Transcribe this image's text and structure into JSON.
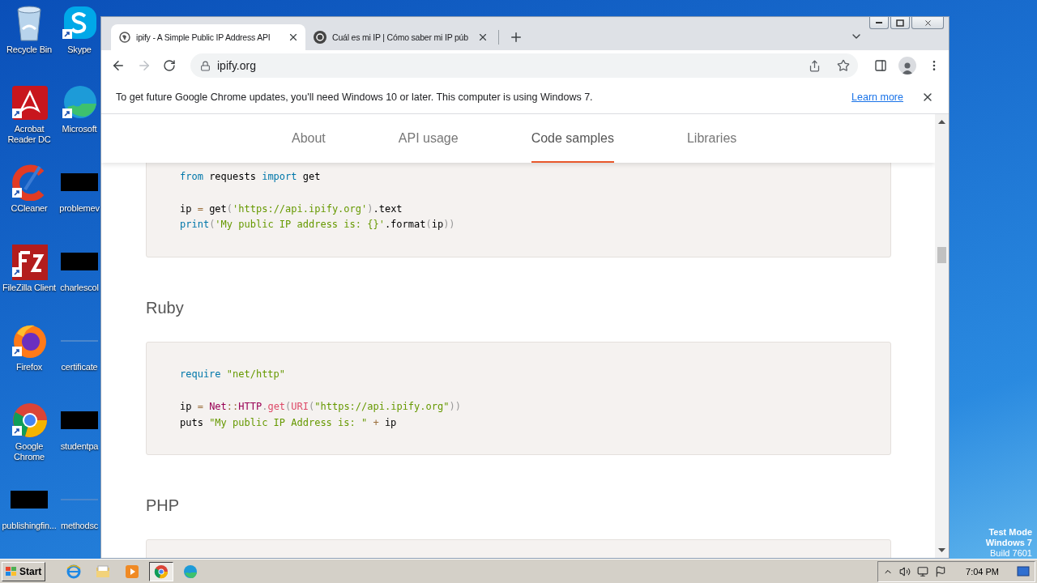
{
  "desktop": {
    "icons": [
      {
        "kind": "recycle",
        "label": "Recycle Bin"
      },
      {
        "kind": "skype",
        "label": "Skype"
      },
      {
        "kind": "acrobat",
        "label": "Acrobat Reader DC"
      },
      {
        "kind": "edge",
        "label": "Microsoft"
      },
      {
        "kind": "ccleaner",
        "label": "CCleaner"
      },
      {
        "kind": "redacted",
        "label": "problemev"
      },
      {
        "kind": "filezilla",
        "label": "FileZilla Client"
      },
      {
        "kind": "redacted",
        "label": "charlescol"
      },
      {
        "kind": "firefox",
        "label": "Firefox"
      },
      {
        "kind": "blank",
        "label": "certificate"
      },
      {
        "kind": "chrome",
        "label": "Google Chrome"
      },
      {
        "kind": "redacted",
        "label": "studentpa"
      },
      {
        "kind": "redacted",
        "label": "publishingfin..."
      },
      {
        "kind": "blank",
        "label": "methodsc"
      }
    ],
    "os_notice": [
      "Test Mode",
      "Windows 7",
      "Build 7601"
    ]
  },
  "browser": {
    "tabs": [
      {
        "title": "ipify - A Simple Public IP Address API",
        "selected": true,
        "kind": "globe"
      },
      {
        "title": "Cuál es mi IP | Cómo saber mi IP púb",
        "selected": false,
        "kind": "ring"
      }
    ],
    "address": "ipify.org",
    "infobar": {
      "message": "To get future Google Chrome updates, you'll need Windows 10 or later. This computer is using Windows 7.",
      "link": "Learn more"
    },
    "site_nav": [
      {
        "label": "About",
        "selected": false
      },
      {
        "label": "API usage",
        "selected": false
      },
      {
        "label": "Code samples",
        "selected": true
      },
      {
        "label": "Libraries",
        "selected": false
      }
    ],
    "sections": [
      {
        "code": [
          {
            "kind": "code",
            "tokens": [
              {
                "t": "from",
                "kind": "kw"
              },
              {
                "t": " requests ",
                "kind": "plain"
              },
              {
                "t": "import",
                "kind": "kw"
              },
              {
                "t": " get",
                "kind": "plain"
              }
            ]
          },
          {
            "kind": "blank"
          },
          {
            "kind": "code",
            "tokens": [
              {
                "t": "ip ",
                "kind": "plain"
              },
              {
                "t": "=",
                "kind": "op"
              },
              {
                "t": " get",
                "kind": "plain"
              },
              {
                "t": "(",
                "kind": "punct"
              },
              {
                "t": "'https://api.ipify.org'",
                "kind": "str"
              },
              {
                "t": ")",
                "kind": "punct"
              },
              {
                "t": ".text",
                "kind": "plain"
              }
            ]
          },
          {
            "kind": "code",
            "tokens": [
              {
                "t": "print",
                "kind": "kw"
              },
              {
                "t": "(",
                "kind": "punct"
              },
              {
                "t": "'My public IP address is: {}'",
                "kind": "str"
              },
              {
                "t": ".format",
                "kind": "plain"
              },
              {
                "t": "(",
                "kind": "punct"
              },
              {
                "t": "ip",
                "kind": "plain"
              },
              {
                "t": "))",
                "kind": "punct"
              }
            ]
          }
        ]
      },
      {
        "heading": "Ruby",
        "code": [
          {
            "kind": "code",
            "tokens": [
              {
                "t": "require ",
                "kind": "kw"
              },
              {
                "t": "\"net/http\"",
                "kind": "str"
              }
            ]
          },
          {
            "kind": "blank"
          },
          {
            "kind": "code",
            "tokens": [
              {
                "t": "ip ",
                "kind": "plain"
              },
              {
                "t": "= ",
                "kind": "op"
              },
              {
                "t": "Net",
                "kind": "class"
              },
              {
                "t": "::",
                "kind": "op"
              },
              {
                "t": "HTTP",
                "kind": "class"
              },
              {
                "t": ".",
                "kind": "punct"
              },
              {
                "t": "get",
                "kind": "fn"
              },
              {
                "t": "(",
                "kind": "punct"
              },
              {
                "t": "URI",
                "kind": "fn"
              },
              {
                "t": "(",
                "kind": "punct"
              },
              {
                "t": "\"https://api.ipify.org\"",
                "kind": "str"
              },
              {
                "t": "))",
                "kind": "punct"
              }
            ]
          },
          {
            "kind": "code",
            "tokens": [
              {
                "t": "puts ",
                "kind": "plain"
              },
              {
                "t": "\"My public IP Address is: \" ",
                "kind": "str"
              },
              {
                "t": "+",
                "kind": "op"
              },
              {
                "t": " ip",
                "kind": "plain"
              }
            ]
          }
        ]
      },
      {
        "heading": "PHP"
      }
    ]
  },
  "taskbar": {
    "start": "Start",
    "apps": [
      {
        "kind": "ie",
        "selected": false
      },
      {
        "kind": "explorer",
        "selected": false
      },
      {
        "kind": "media",
        "selected": false
      },
      {
        "kind": "chrome",
        "selected": true
      },
      {
        "kind": "edge",
        "selected": false
      }
    ],
    "clock": "7:04 PM"
  }
}
